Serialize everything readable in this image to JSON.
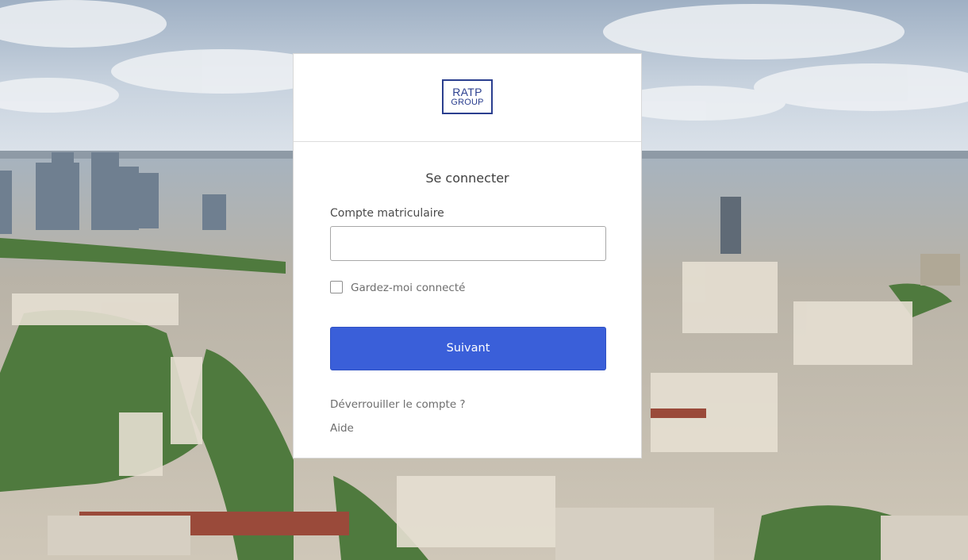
{
  "logo": {
    "line1": "RATP",
    "line2": "GROUP",
    "color": "#2b3f8f"
  },
  "login": {
    "title": "Se connecter",
    "field_label": "Compte matriculaire",
    "field_value": "",
    "field_placeholder": "",
    "remember_label": "Gardez-moi connecté",
    "remember_checked": false,
    "submit_label": "Suivant",
    "unlock_link": "Déverrouiller le compte ?",
    "help_link": "Aide"
  },
  "colors": {
    "primary": "#3a5fd9",
    "text": "#404040",
    "muted": "#6e6e6e"
  }
}
